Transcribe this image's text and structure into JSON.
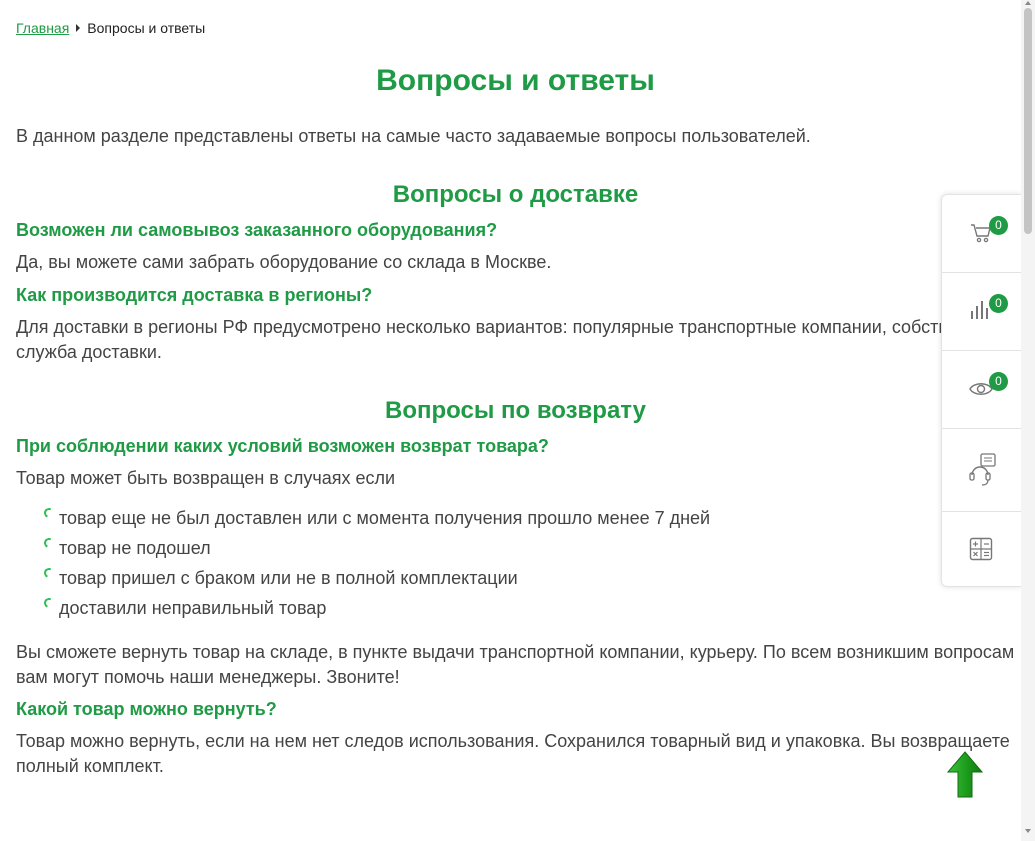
{
  "breadcrumb": {
    "home": "Главная",
    "current": "Вопросы и ответы"
  },
  "page_title": "Вопросы и ответы",
  "intro": "В данном разделе представлены ответы на самые часто задаваемые вопросы пользователей.",
  "delivery": {
    "title": "Вопросы о доставке",
    "q1": "Возможен ли самовывоз заказанного оборудования?",
    "a1": "Да, вы можете сами забрать оборудование со склада в Москве.",
    "q2": "Как производится доставка в регионы?",
    "a2_line1": "Для доставки в регионы РФ предусмотрено несколько вариантов: популярные транспортные компании, собственная",
    "a2_line2": "служба доставки."
  },
  "returns": {
    "title": "Вопросы по возврату",
    "q1": "При соблюдении каких условий возможен возврат товара?",
    "a1": "Товар может быть возвращен в случаях если",
    "conditions": [
      "товар еще не был доставлен или с момента получения прошло менее 7 дней",
      "товар не подошел",
      "товар пришел с браком или не в полной комплектации",
      "доставили неправильный товар"
    ],
    "note": "Вы сможете вернуть товар на складе, в пункте выдачи транспортной компании, курьеру. По всем возникшим вопросам вам могут помочь наши менеджеры. Звоните!",
    "q2": "Какой товар можно вернуть?",
    "a2": "Товар можно вернуть, если на нем нет следов использования. Сохранился товарный вид и упаковка. Вы возвращаете полный комплект."
  },
  "side_panel": {
    "cart_count": "0",
    "compare_count": "0",
    "viewed_count": "0",
    "icons": [
      "cart-icon",
      "compare-icon",
      "eye-icon",
      "support-icon",
      "calculator-icon"
    ]
  },
  "colors": {
    "accent": "#1f9a45",
    "text": "#444444",
    "bullet": "#2fbf55"
  }
}
